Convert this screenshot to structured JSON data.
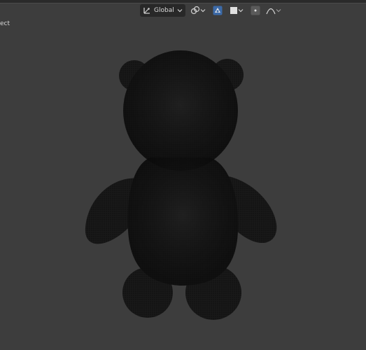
{
  "viewport": {
    "mode_label": "ect",
    "transform_orientation": {
      "label": "Global",
      "icon": "transform-orientation-icon"
    },
    "header_tools": [
      {
        "name": "pivot-point-icon"
      },
      {
        "name": "snap-icon"
      },
      {
        "name": "proportional-editing-icon"
      },
      {
        "name": "falloff-curve-icon"
      }
    ]
  },
  "colors": {
    "background": "#3d3d3d",
    "object": "#141414",
    "header_dropdown": "#282828"
  }
}
